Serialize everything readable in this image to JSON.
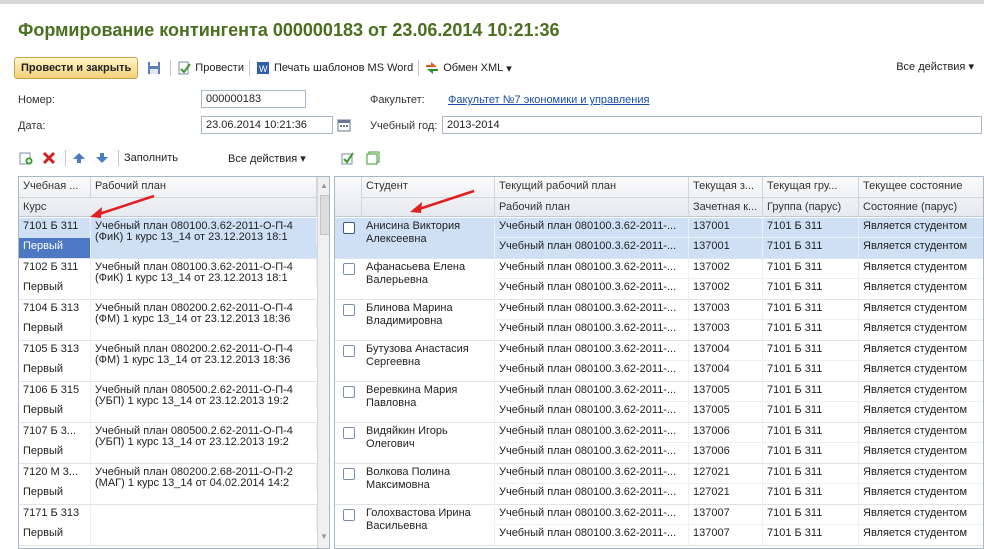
{
  "title": "Формирование контингента 000000183 от 23.06.2014 10:21:36",
  "toolbar": {
    "post_close": "Провести и закрыть",
    "post": "Провести",
    "print_word": "Печать шаблонов MS Word",
    "xml_exchange": "Обмен XML",
    "all_actions": "Все действия"
  },
  "form": {
    "number_label": "Номер:",
    "number_value": "000000183",
    "date_label": "Дата:",
    "date_value": "23.06.2014 10:21:36",
    "faculty_label": "Факультет:",
    "faculty_value": "Факультет №7 экономики и управления",
    "year_label": "Учебный год:",
    "year_value": "2013-2014"
  },
  "left_toolbar": {
    "fill": "Заполнить",
    "all_actions": "Все действия"
  },
  "left_grid": {
    "headers": [
      "Учебная ...",
      "Рабочий план"
    ],
    "subheader": "Курс",
    "rows": [
      {
        "group": "7101 Б 311",
        "course": "Первый",
        "plan": "Учебный план 080100.3.62-2011-О-П-4",
        "plan2": "(ФиК) 1 курс 13_14 от 23.12.2013 18:1"
      },
      {
        "group": "7102 Б 311",
        "course": "Первый",
        "plan": "Учебный план 080100.3.62-2011-О-П-4",
        "plan2": "(ФиК) 1 курс 13_14 от 23.12.2013 18:1"
      },
      {
        "group": "7104 Б 313",
        "course": "Первый",
        "plan": "Учебный план 080200.2.62-2011-О-П-4",
        "plan2": "(ФМ) 1 курс 13_14 от 23.12.2013 18:36"
      },
      {
        "group": "7105 Б 313",
        "course": "Первый",
        "plan": "Учебный план 080200.2.62-2011-О-П-4",
        "plan2": "(ФМ) 1 курс 13_14 от 23.12.2013 18:36"
      },
      {
        "group": "7106 Б 315",
        "course": "Первый",
        "plan": "Учебный план 080500.2.62-2011-О-П-4",
        "plan2": "(УБП) 1 курс 13_14 от 23.12.2013 19:2"
      },
      {
        "group": "7107 Б 3...",
        "course": "Первый",
        "plan": "Учебный план 080500.2.62-2011-О-П-4",
        "plan2": "(УБП) 1 курс 13_14 от 23.12.2013 19:2"
      },
      {
        "group": "7120 М 3...",
        "course": "Первый",
        "plan": "Учебный план 080200.2.68-2011-О-П-2",
        "plan2": "(МАГ) 1 курс 13_14 от 04.02.2014 14:2"
      },
      {
        "group": "7171 Б 313",
        "course": "Первый",
        "plan": "",
        "plan2": ""
      }
    ]
  },
  "right_grid": {
    "headers": [
      "Студент",
      "Текущий рабочий план",
      "Текущая з...",
      "Текущая гру...",
      "Текущее состояние"
    ],
    "subheaders": [
      "",
      "Рабочий план",
      "Зачетная к...",
      "Группа (парус)",
      "Состояние (парус)"
    ],
    "rows": [
      {
        "name": "Анисина Виктория Алексеевна",
        "plan": "Учебный план 080100.3.62-2011-...",
        "book": "137001",
        "group": "7101 Б 311",
        "state": "Является студентом"
      },
      {
        "name": "Афанасьева Елена Валерьевна",
        "plan": "Учебный план 080100.3.62-2011-...",
        "book": "137002",
        "group": "7101 Б 311",
        "state": "Является студентом"
      },
      {
        "name": "Блинова Марина Владимировна",
        "plan": "Учебный план 080100.3.62-2011-...",
        "book": "137003",
        "group": "7101 Б 311",
        "state": "Является студентом"
      },
      {
        "name": "Бутузова Анастасия Сергеевна",
        "plan": "Учебный план 080100.3.62-2011-...",
        "book": "137004",
        "group": "7101 Б 311",
        "state": "Является студентом"
      },
      {
        "name": "Веревкина Мария Павловна",
        "plan": "Учебный план 080100.3.62-2011-...",
        "book": "137005",
        "group": "7101 Б 311",
        "state": "Является студентом"
      },
      {
        "name": "Видяйкин Игорь Олегович",
        "plan": "Учебный план 080100.3.62-2011-...",
        "book": "137006",
        "group": "7101 Б 311",
        "state": "Является студентом"
      },
      {
        "name": "Волкова Полина Максимовна",
        "plan": "Учебный план 080100.3.62-2011-...",
        "book": "127021",
        "group": "7101 Б 311",
        "state": "Является студентом"
      },
      {
        "name": "Голохвастова Ирина Васильевна",
        "plan": "Учебный план 080100.3.62-2011-...",
        "book": "137007",
        "group": "7101 Б 311",
        "state": "Является студентом"
      }
    ]
  },
  "colors": {
    "title": "#4a6f1e",
    "selection": "#cfe0f5",
    "arrow": "#e02020"
  }
}
